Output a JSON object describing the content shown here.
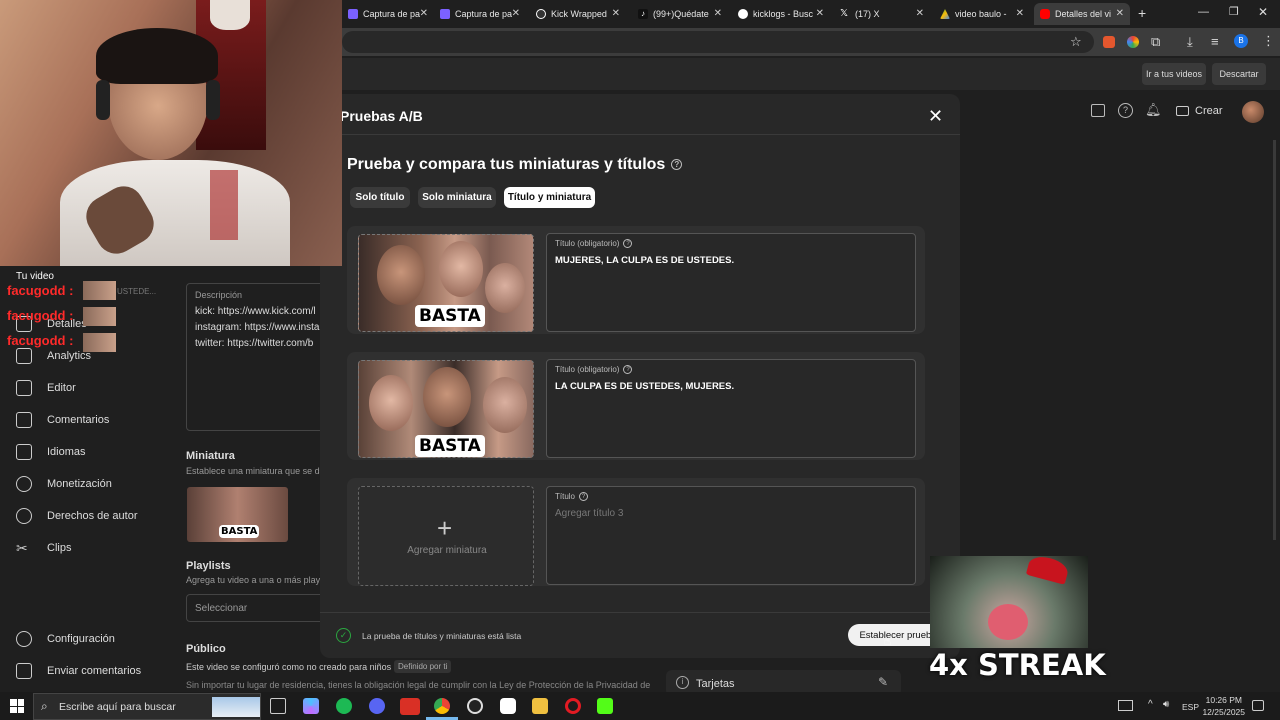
{
  "browser": {
    "tabs": [
      {
        "label": "Captura de pa",
        "color": "#7b61ff"
      },
      {
        "label": "Captura de pa",
        "color": "#7b61ff"
      },
      {
        "label": "Kick Wrapped",
        "color": "#53fc18"
      },
      {
        "label": "(99+)Quédate",
        "color": "#ffffff"
      },
      {
        "label": "kicklogs - Busc",
        "color": "#4285f4"
      },
      {
        "label": "(17) X",
        "color": "#ffffff"
      },
      {
        "label": "video baulo - ",
        "color": "#34a853"
      },
      {
        "label": "Detalles del vi",
        "color": "#ff0000"
      }
    ],
    "new_tab": "+"
  },
  "studio": {
    "header_buttons": {
      "go_videos": "Ir a tus videos",
      "discard": "Descartar"
    },
    "create": "Crear",
    "sidebar": {
      "tu_video": "Tu video",
      "items": [
        "Detalles",
        "Analytics",
        "Editor",
        "Comentarios",
        "Idiomas",
        "Monetización",
        "Derechos de autor",
        "Clips"
      ],
      "bottom": [
        "Configuración",
        "Enviar comentarios"
      ]
    },
    "chat": {
      "user": "facugodd",
      "snippet": "USTEDE..."
    },
    "description": {
      "label": "Descripción",
      "lines": [
        "kick: https://www.kick.com/l",
        "instagram: https://www.insta",
        "twitter: https://twitter.com/b"
      ]
    },
    "thumbnail_section": {
      "title": "Miniatura",
      "hint": "Establece una miniatura que se de"
    },
    "playlists": {
      "title": "Playlists",
      "hint": "Agrega tu video a una o más playli",
      "select": "Seleccionar"
    },
    "public": {
      "title": "Público",
      "line1": "Este video se configuró como no creado para niños",
      "badge": "Definido por ti",
      "line2": "Sin importar tu lugar de residencia, tienes la obligación legal de cumplir con la Ley de Protección de la Privacidad de"
    },
    "cards_label": "Tarjetas"
  },
  "modal": {
    "header": "Pruebas A/B",
    "title": "Prueba y compara tus miniaturas y títulos",
    "chips": [
      "Solo título",
      "Solo miniatura",
      "Título y miniatura"
    ],
    "active_chip": 2,
    "entries": [
      {
        "label": "Título (obligatorio)",
        "value": "MUJERES, LA CULPA ES DE USTEDES.",
        "thumb_text": "BASTA"
      },
      {
        "label": "Título (obligatorio)",
        "value": "LA CULPA ES DE USTEDES, MUJERES.",
        "thumb_text": "BASTA"
      },
      {
        "label": "Título",
        "placeholder": "Agregar título 3",
        "add_thumb": "Agregar miniatura"
      }
    ],
    "footer_status": "La prueba de títulos y miniaturas está lista",
    "submit": "Establecer prueba"
  },
  "overlay": {
    "streak": "4x STREAK"
  },
  "taskbar": {
    "search_placeholder": "Escribe aquí para buscar",
    "lang": "ESP",
    "time": "10:26 PM",
    "date": "12/25/2025"
  }
}
